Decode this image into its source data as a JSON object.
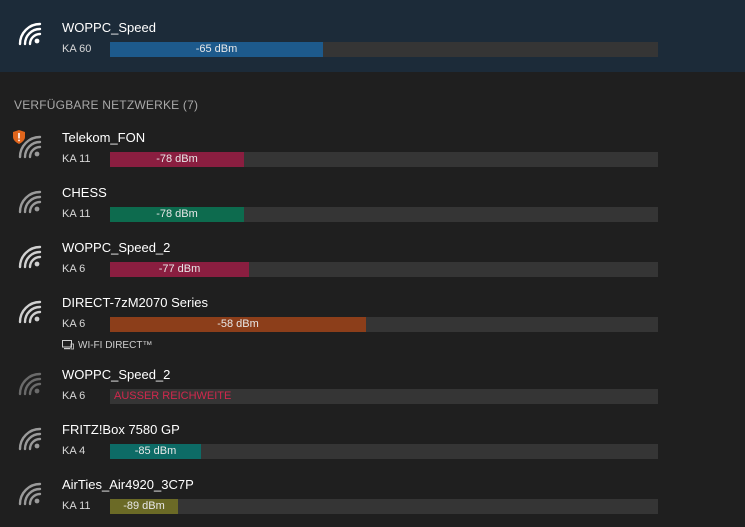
{
  "connected": {
    "name": "WOPPC_Speed",
    "channel": "KA 60",
    "signal": "-65 dBm",
    "strength_fraction": 0.388,
    "bar_color": "#1d5a8c"
  },
  "section_header": "VERFÜGBARE NETZWERKE (7)",
  "networks": [
    {
      "name": "Telekom_FON",
      "channel": "KA 11",
      "signal": "-78 dBm",
      "strength_fraction": 0.244,
      "bar_color": "#8a1e40",
      "warning": true
    },
    {
      "name": "CHESS",
      "channel": "KA 11",
      "signal": "-78 dBm",
      "strength_fraction": 0.244,
      "bar_color": "#0d6b4e"
    },
    {
      "name": "WOPPC_Speed_2",
      "channel": "KA 6",
      "signal": "-77 dBm",
      "strength_fraction": 0.254,
      "bar_color": "#8a1e40"
    },
    {
      "name": "DIRECT-7zM2070 Series",
      "channel": "KA 6",
      "signal": "-58 dBm",
      "strength_fraction": 0.467,
      "bar_color": "#8c3e1a",
      "tag": "WI-FI DIRECT™"
    },
    {
      "name": "WOPPC_Speed_2",
      "channel": "KA 6",
      "status": "AUSSER REICHWEITE",
      "out_of_range": true
    },
    {
      "name": "FRITZ!Box 7580 GP",
      "channel": "KA 4",
      "signal": "-85 dBm",
      "strength_fraction": 0.166,
      "bar_color": "#0d6b66"
    },
    {
      "name": "AirTies_Air4920_3C7P",
      "channel": "KA 11",
      "signal": "-89 dBm",
      "strength_fraction": 0.124,
      "bar_color": "#6b6a26"
    }
  ],
  "icons": {
    "wifi": "wifi-signal-icon",
    "warning": "security-warning-shield-icon",
    "wifi_direct": "wifi-direct-device-icon",
    "cursor": "mouse-cursor-icon"
  }
}
